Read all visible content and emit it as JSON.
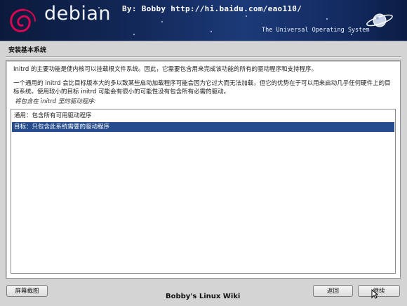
{
  "banner": {
    "logo_text": "debian",
    "watermark": "By: Bobby  http://hi.baidu.com/eao110/",
    "tagline": "The Universal Operating System",
    "logo_color": "#d70751"
  },
  "step": {
    "title": "安装基本系统"
  },
  "content": {
    "paragraph1": "Initrd 的主要功能是使内核可以挂载根文件系统。因此，它需要包含用来完成该功能的所有的驱动程序和支持程序。",
    "paragraph2": "一个通用的 initrd 会比目标版本大的多以致某些启动加载程序可能会因为它过大而无法加载，但它的优势在于可以用来启动几乎任何硬件上的目标系统。使用较小的目标 initrd 可能会有很小的可能性没有包含所有必需的驱动。",
    "prompt": "将包含在 initrd 里的驱动程序:"
  },
  "options": [
    {
      "label": "通用：包含所有可用驱动程序",
      "selected": false
    },
    {
      "label": "目标：只包含此系统需要的驱动程序",
      "selected": true
    }
  ],
  "buttons": {
    "screenshot": "屏幕截图",
    "back": "返回",
    "continue": "继续"
  },
  "footer": {
    "credit": "Bobby's Linux Wiki"
  },
  "colors": {
    "selection": "#254d8d",
    "banner_dark": "#0b1a3c"
  }
}
